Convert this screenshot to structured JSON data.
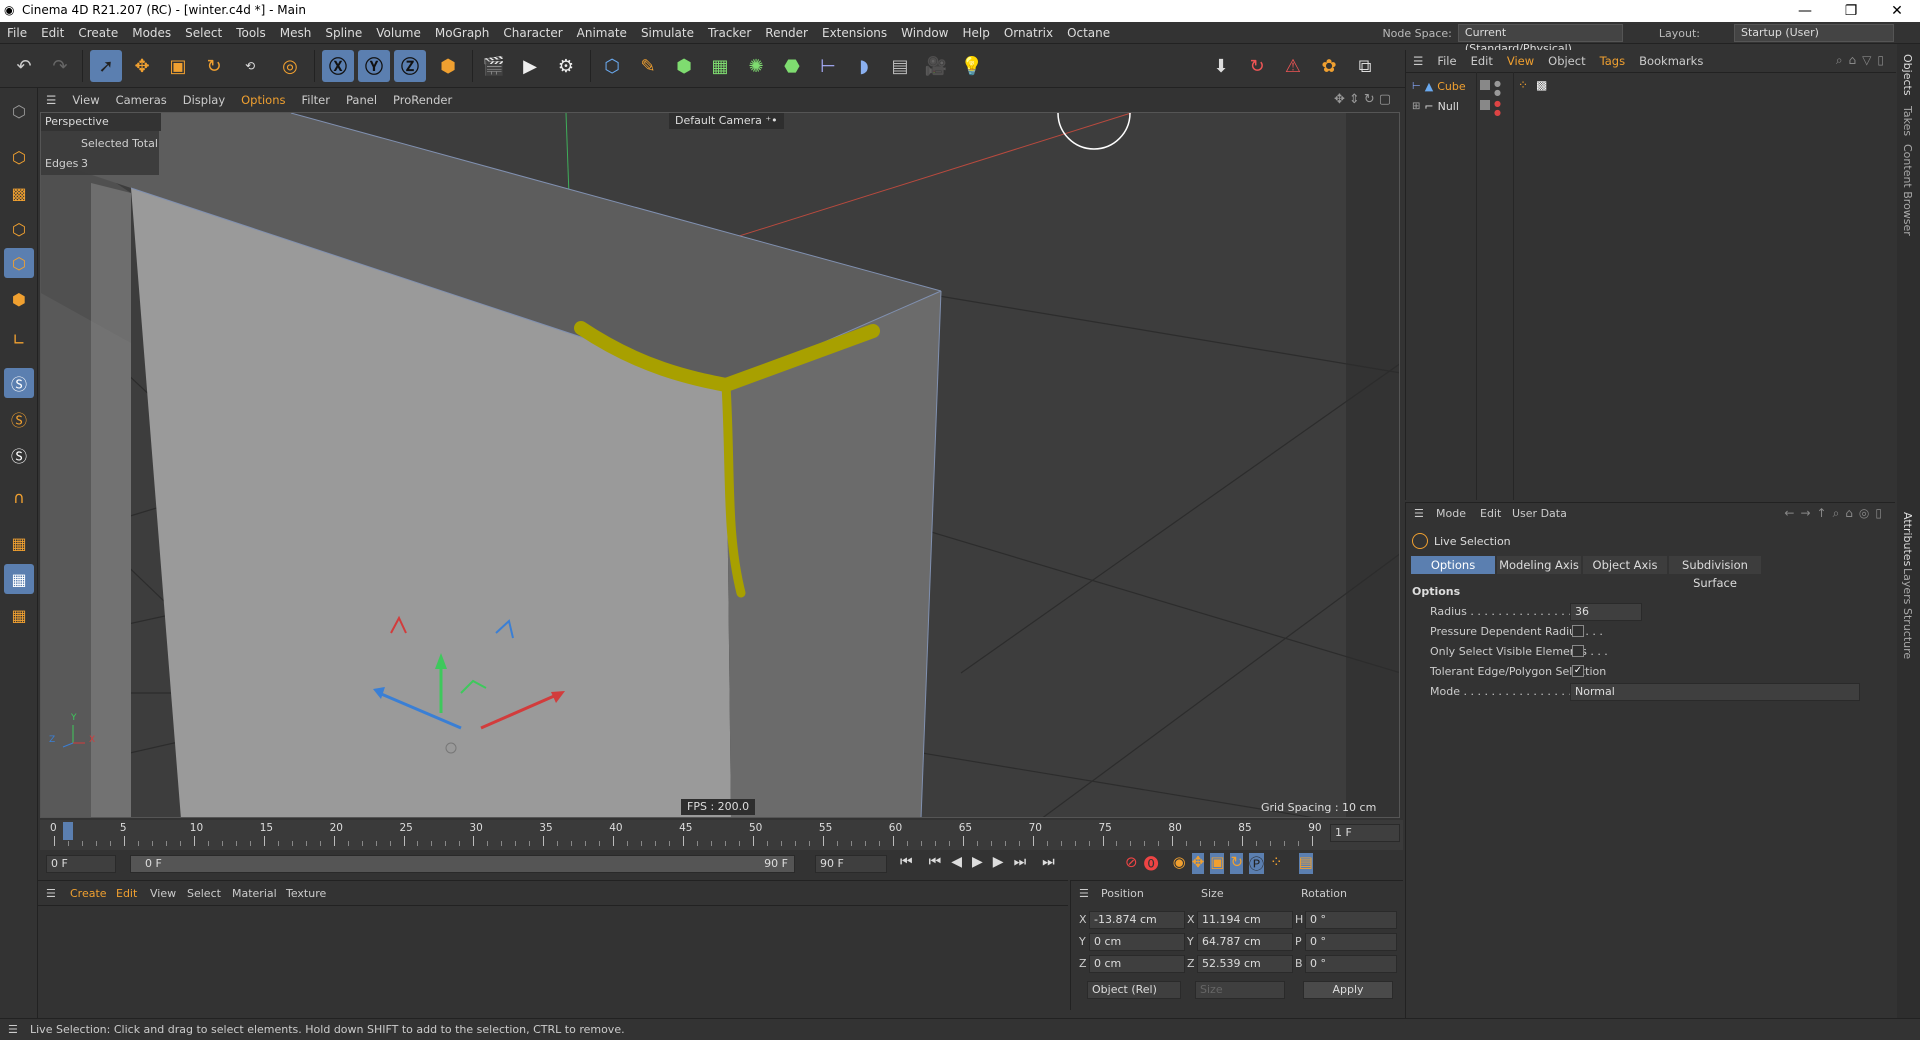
{
  "window": {
    "title": "Cinema 4D R21.207 (RC) - [winter.c4d *] - Main",
    "buttons": [
      "—",
      "❐",
      "✕"
    ]
  },
  "menu": [
    "File",
    "Edit",
    "Create",
    "Modes",
    "Select",
    "Tools",
    "Mesh",
    "Spline",
    "Volume",
    "MoGraph",
    "Character",
    "Animate",
    "Simulate",
    "Tracker",
    "Render",
    "Extensions",
    "Window",
    "Help",
    "Ornatrix",
    "Octane"
  ],
  "node_space": {
    "label": "Node Space:",
    "value": "Current (Standard/Physical)"
  },
  "layout": {
    "label": "Layout:",
    "value": "Startup (User)"
  },
  "viewport": {
    "menu": [
      "View",
      "Cameras",
      "Display",
      "Options",
      "Filter",
      "Panel",
      "ProRender"
    ],
    "name": "Perspective",
    "camera": "Default Camera",
    "stats_header": "Selected Total",
    "stats_label": "Edges",
    "stats_value": "3",
    "fps": "FPS : 200.0",
    "grid_spacing": "Grid Spacing : 10 cm",
    "axis_y": "Y",
    "axis_z": "Z",
    "axis_x": "X"
  },
  "objects": {
    "menu": [
      "File",
      "Edit",
      "View",
      "Object",
      "Tags",
      "Bookmarks"
    ],
    "items": [
      {
        "name": "Cube",
        "color": "#f0a040"
      },
      {
        "name": "Null",
        "color": "#cccccc"
      }
    ]
  },
  "attributes": {
    "menu": [
      "Mode",
      "Edit",
      "User Data"
    ],
    "tool_name": "Live Selection",
    "tabs": [
      "Options",
      "Modeling Axis",
      "Object Axis",
      "Subdivision Surface"
    ],
    "section": "Options",
    "radius_label": "Radius . . . . . . . . . . . . . . . . . . .",
    "radius_value": "36",
    "pressure_label": "Pressure Dependent Radius . . .",
    "visible_label": "Only Select Visible Elements . . .",
    "tolerant_label": "Tolerant Edge/Polygon Selection",
    "mode_label": "Mode . . . . . . . . . . . . . . . . . . . .",
    "mode_value": "Normal",
    "side_tabs": [
      "Attributes",
      "Layers",
      "Structure"
    ]
  },
  "right_side_tabs": [
    "Objects",
    "Takes",
    "Content Browser"
  ],
  "timeline": {
    "ticks": [
      "0",
      "5",
      "10",
      "15",
      "20",
      "25",
      "30",
      "35",
      "40",
      "45",
      "50",
      "55",
      "60",
      "65",
      "70",
      "75",
      "80",
      "85",
      "90"
    ],
    "current_frame": "1 F",
    "start": "0 F",
    "range_start": "0 F",
    "range_end": "90 F",
    "end": "90 F"
  },
  "material": {
    "menu": [
      "Create",
      "Edit",
      "View",
      "Select",
      "Material",
      "Texture"
    ]
  },
  "coords": {
    "headers": [
      "Position",
      "Size",
      "Rotation"
    ],
    "rows": [
      {
        "axis": "X",
        "pos": "-13.874 cm",
        "saxis": "X",
        "size": "11.194 cm",
        "raxis": "H",
        "rot": "0 °"
      },
      {
        "axis": "Y",
        "pos": "0 cm",
        "saxis": "Y",
        "size": "64.787 cm",
        "raxis": "P",
        "rot": "0 °"
      },
      {
        "axis": "Z",
        "pos": "0 cm",
        "saxis": "Z",
        "size": "52.539 cm",
        "raxis": "B",
        "rot": "0 °"
      }
    ],
    "mode": "Object (Rel)",
    "size_mode": "Size",
    "apply": "Apply"
  },
  "status": "Live Selection: Click and drag to select elements. Hold down SHIFT to add to the selection, CTRL to remove."
}
